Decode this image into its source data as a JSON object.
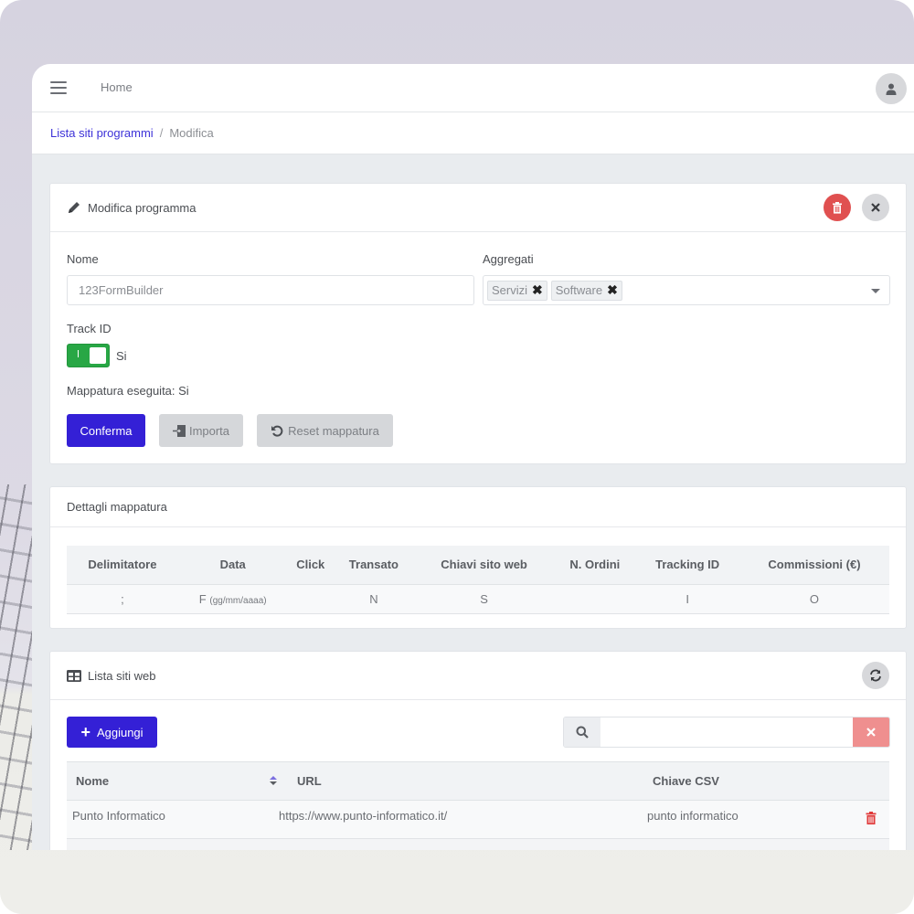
{
  "topbar": {
    "menu_icon": "hamburger-icon",
    "home_label": "Home",
    "avatar_icon": "user-icon"
  },
  "breadcrumb": {
    "parent": "Lista siti programmi",
    "separator": "/",
    "current": "Modifica"
  },
  "edit_card": {
    "title": "Modifica programma",
    "title_icon": "pencil-icon",
    "delete_icon": "trash-icon",
    "close_icon": "close-icon",
    "name_label": "Nome",
    "name_value": "123FormBuilder",
    "aggregati_label": "Aggregati",
    "aggregati_tags": [
      "Servizi",
      "Software"
    ],
    "track_id_label": "Track ID",
    "track_id_enabled": true,
    "track_id_state_text": "Si",
    "mapping_status": "Mappatura eseguita: Si",
    "buttons": {
      "confirm": "Conferma",
      "import": "Importa",
      "reset": "Reset mappatura"
    },
    "colors": {
      "primary": "#3420d6",
      "danger": "#e05050",
      "toggle_on": "#28a745"
    }
  },
  "mapping_card": {
    "title": "Dettagli mappatura",
    "columns": [
      "Delimitatore",
      "Data",
      "Click",
      "Transato",
      "Chiavi sito web",
      "N. Ordini",
      "Tracking ID",
      "Commissioni (€)"
    ],
    "row": {
      "delimitatore": ";",
      "data": "F",
      "data_format": "(gg/mm/aaaa)",
      "click": "",
      "transato": "N",
      "chiavi_sito_web": "S",
      "n_ordini": "",
      "tracking_id": "I",
      "commissioni": "O"
    }
  },
  "sites_card": {
    "title": "Lista siti web",
    "title_icon": "table-icon",
    "refresh_icon": "refresh-icon",
    "add_button": "Aggiungi",
    "search_value": "",
    "search_placeholder": "",
    "columns": [
      "Nome",
      "URL",
      "Chiave CSV"
    ],
    "rows": [
      {
        "nome": "Punto Informatico",
        "url": "https://www.punto-informatico.it/",
        "chiave_csv": "punto informatico"
      }
    ]
  }
}
